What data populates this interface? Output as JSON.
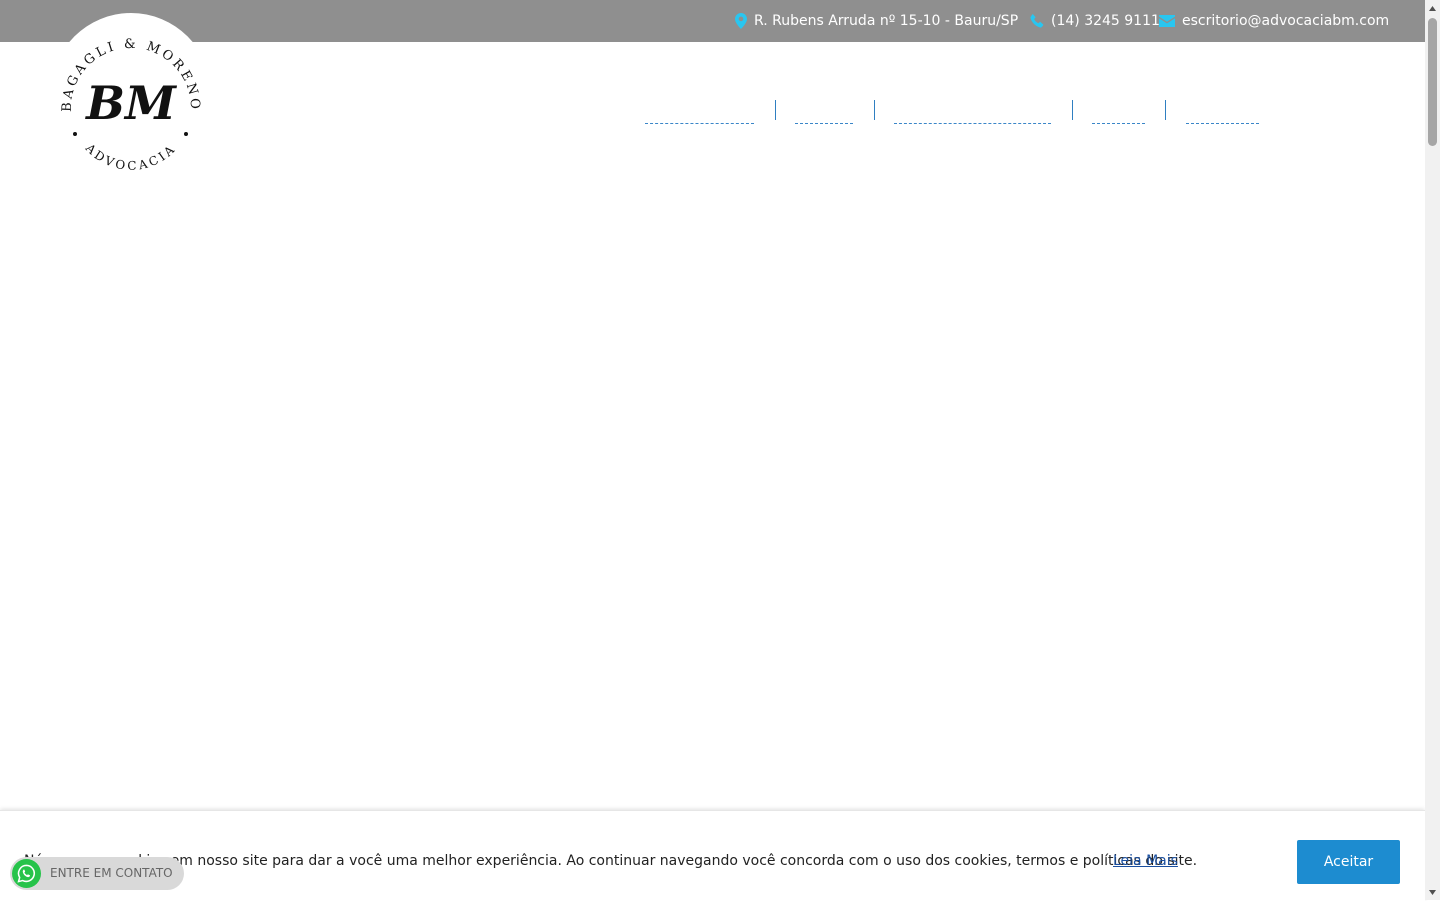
{
  "topbar": {
    "address": "R. Rubens Arruda nº 15-10 - Bauru/SP",
    "address_icon": "map-marker-icon",
    "phone": "(14) 3245 9111",
    "phone_icon": "phone-icon",
    "email": "escritorio@advocaciabm.com",
    "email_icon": "envelope-icon",
    "background": "#8f8f8f",
    "icon_color": "#29c6f0"
  },
  "logo": {
    "top_text": "BAGAGLI & MORENO",
    "monogram": "BM",
    "bottom_text": "ADVOCACIA"
  },
  "nav": {
    "items": [
      {
        "label": ""
      },
      {
        "label": ""
      },
      {
        "label": ""
      },
      {
        "label": ""
      },
      {
        "label": ""
      }
    ]
  },
  "cookie": {
    "text": "Nós usamos cookies em nosso site para dar a você uma melhor experiência. Ao continuar navegando você concorda com o uso dos cookies, termos e políticas do site.",
    "link_label": "Leia Mais",
    "accept_label": "Aceitar",
    "accent": "#1d8cd0"
  },
  "whatsapp": {
    "label": "ENTRE EM CONTATO",
    "icon": "whatsapp-icon",
    "color": "#26c34a"
  }
}
